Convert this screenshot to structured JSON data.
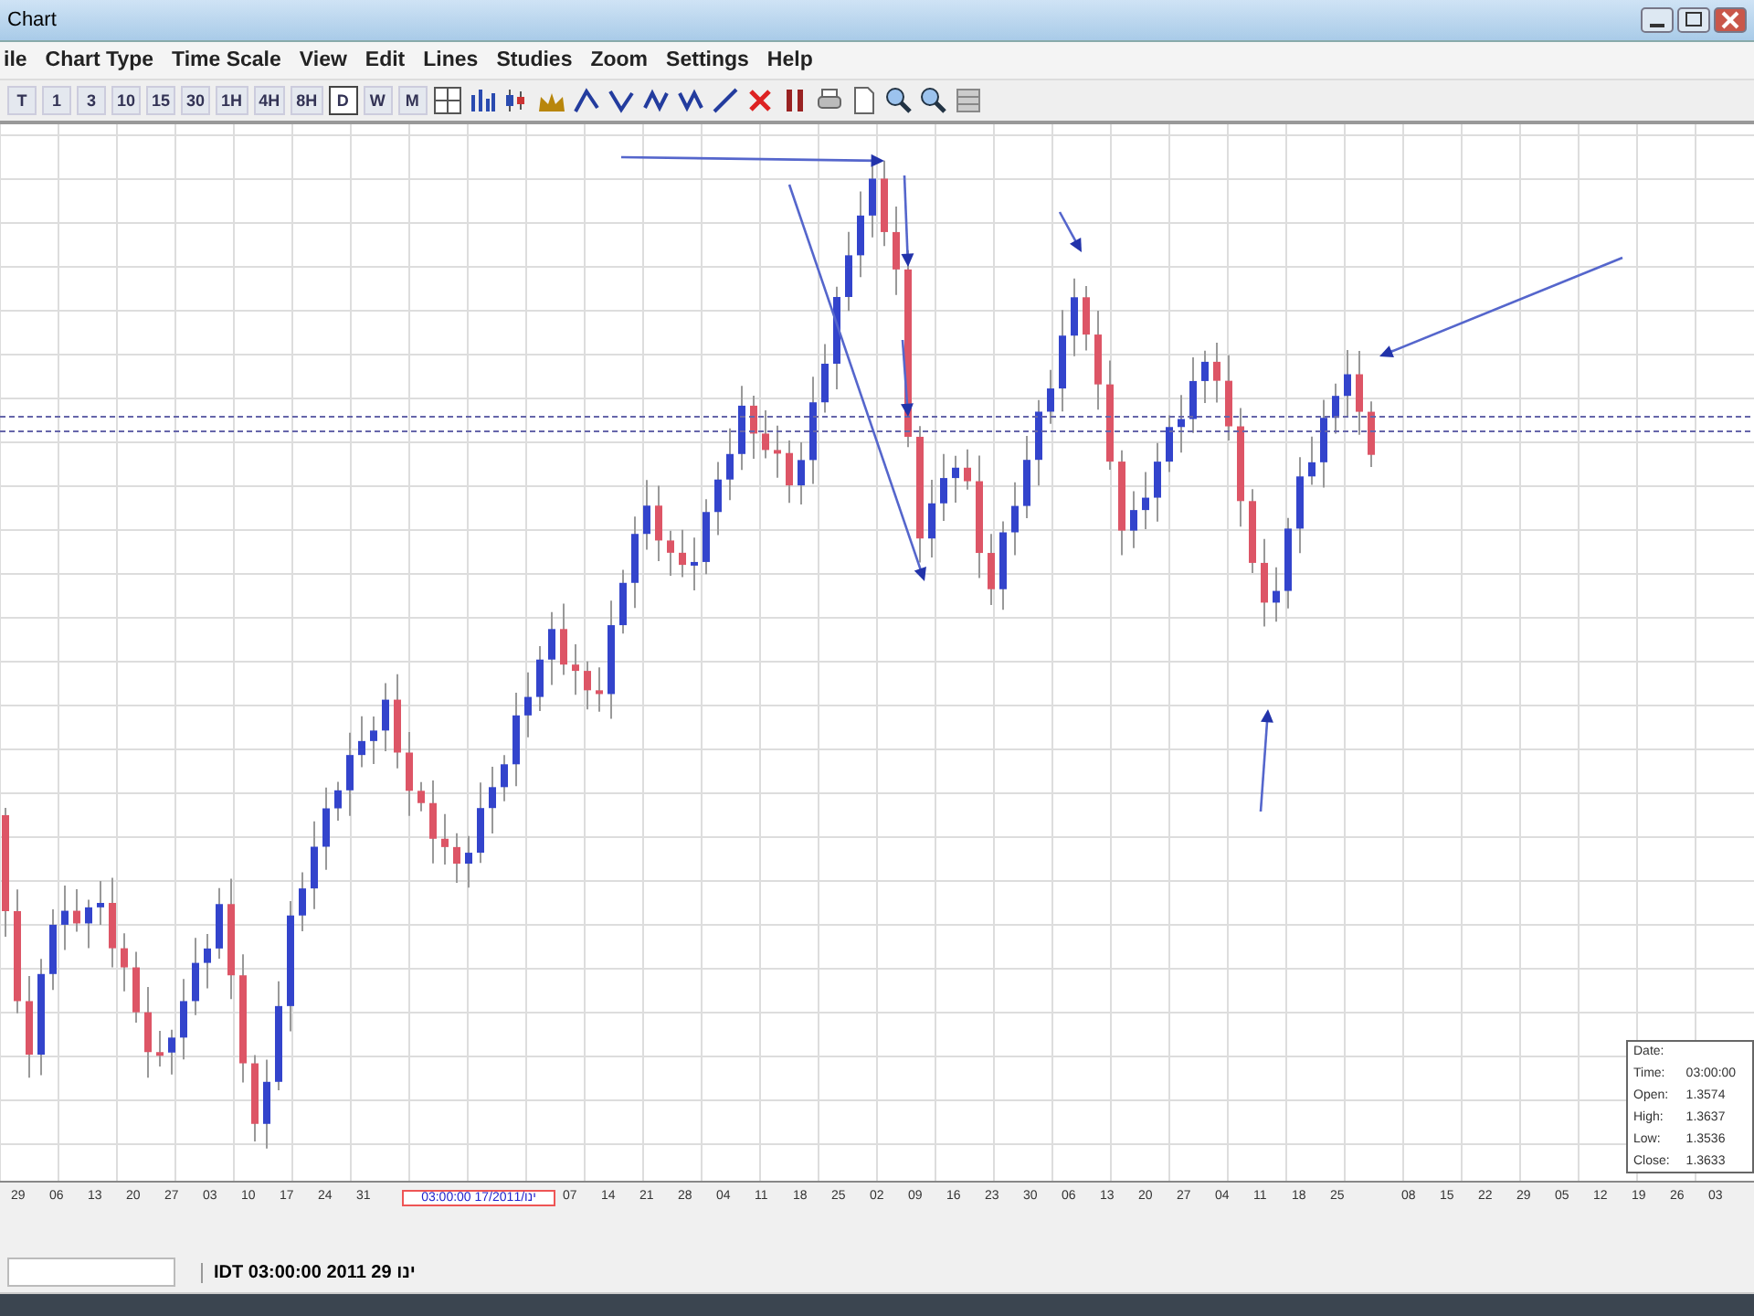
{
  "window": {
    "title": "Chart"
  },
  "menu": [
    "ile",
    "Chart Type",
    "Time Scale",
    "View",
    "Edit",
    "Lines",
    "Studies",
    "Zoom",
    "Settings",
    "Help"
  ],
  "periods": [
    {
      "label": "T",
      "selected": false
    },
    {
      "label": "1",
      "selected": false
    },
    {
      "label": "3",
      "selected": false
    },
    {
      "label": "10",
      "selected": false
    },
    {
      "label": "15",
      "selected": false
    },
    {
      "label": "30",
      "selected": false
    },
    {
      "label": "1H",
      "selected": false
    },
    {
      "label": "4H",
      "selected": false
    },
    {
      "label": "8H",
      "selected": false
    },
    {
      "label": "D",
      "selected": true
    },
    {
      "label": "W",
      "selected": false
    },
    {
      "label": "M",
      "selected": false
    }
  ],
  "time_axis": {
    "ticks": [
      "29",
      "06",
      "13",
      "20",
      "27",
      "03",
      "10",
      "17",
      "24",
      "31",
      "07",
      "14",
      "21",
      "28",
      "04",
      "11",
      "18",
      "25",
      "02",
      "09",
      "16",
      "23",
      "30",
      "06",
      "13",
      "20",
      "27",
      "04",
      "11",
      "18",
      "25",
      "08",
      "15",
      "22",
      "29",
      "05",
      "12",
      "19",
      "26",
      "03"
    ],
    "cursor_label": "03:00:00 17/ינו/2011"
  },
  "data_window": {
    "rows": [
      {
        "label": "Date:",
        "value": ""
      },
      {
        "label": "Time:",
        "value": "03:00:00"
      },
      {
        "label": "Open:",
        "value": "1.3574"
      },
      {
        "label": "High:",
        "value": "1.3637"
      },
      {
        "label": "Low:",
        "value": "1.3536"
      },
      {
        "label": "Close:",
        "value": "1.3633"
      }
    ]
  },
  "status_bar": {
    "time": "IDT 03:00:00 2011 ינו 29"
  }
}
